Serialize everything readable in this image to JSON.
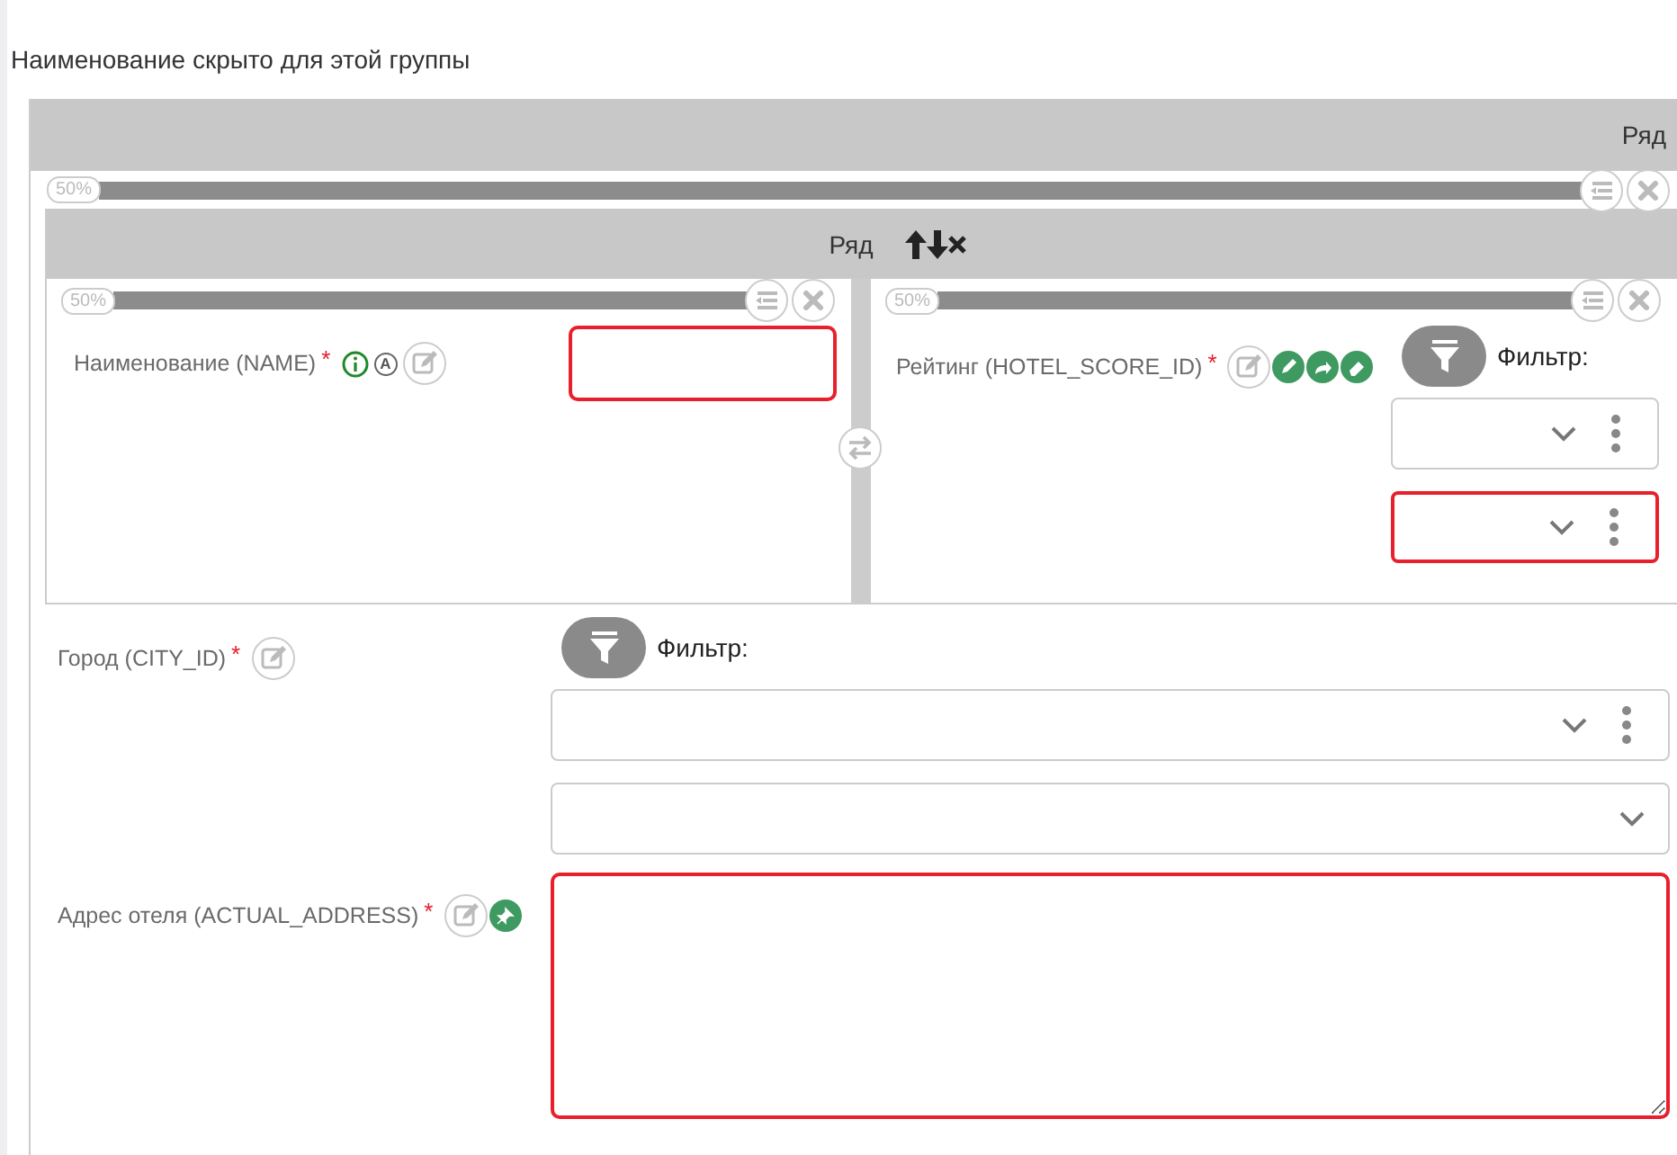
{
  "group_note": "Наименование скрыто для этой группы",
  "outer_row": {
    "title": "Ряд",
    "width_badge": "50%",
    "inner_row": {
      "title": "Ряд",
      "columns": [
        {
          "width_badge": "50%",
          "field": {
            "label": "Наименование (NAME)",
            "required_mark": "*",
            "icons": [
              {
                "kind": "info"
              },
              {
                "kind": "letter",
                "text": "A"
              },
              {
                "kind": "edit"
              }
            ],
            "control": {
              "kind": "text",
              "invalid": true
            }
          }
        },
        {
          "width_badge": "50%",
          "field": {
            "label": "Рейтинг (HOTEL_SCORE_ID)",
            "required_mark": "*",
            "icons": [
              {
                "kind": "edit"
              },
              {
                "kind": "pencil"
              },
              {
                "kind": "share"
              },
              {
                "kind": "eraser"
              }
            ],
            "control": {
              "kind": "filter_select",
              "filter_label": "Фильтр:",
              "selects": [
                {
                  "invalid": false,
                  "menu": true
                },
                {
                  "invalid": true,
                  "menu": true
                }
              ]
            }
          }
        }
      ]
    }
  },
  "fields": [
    {
      "label": "Город (CITY_ID)",
      "required_mark": "*",
      "icons": [
        {
          "kind": "edit"
        }
      ],
      "control": {
        "kind": "filter_select",
        "filter_label": "Фильтр:",
        "selects": [
          {
            "invalid": false,
            "menu": true
          },
          {
            "invalid": false,
            "menu": false
          }
        ]
      }
    },
    {
      "label": "Адрес отеля (ACTUAL_ADDRESS)",
      "required_mark": "*",
      "icons": [
        {
          "kind": "edit"
        },
        {
          "kind": "pin"
        }
      ],
      "control": {
        "kind": "textarea",
        "invalid": true
      }
    }
  ]
}
